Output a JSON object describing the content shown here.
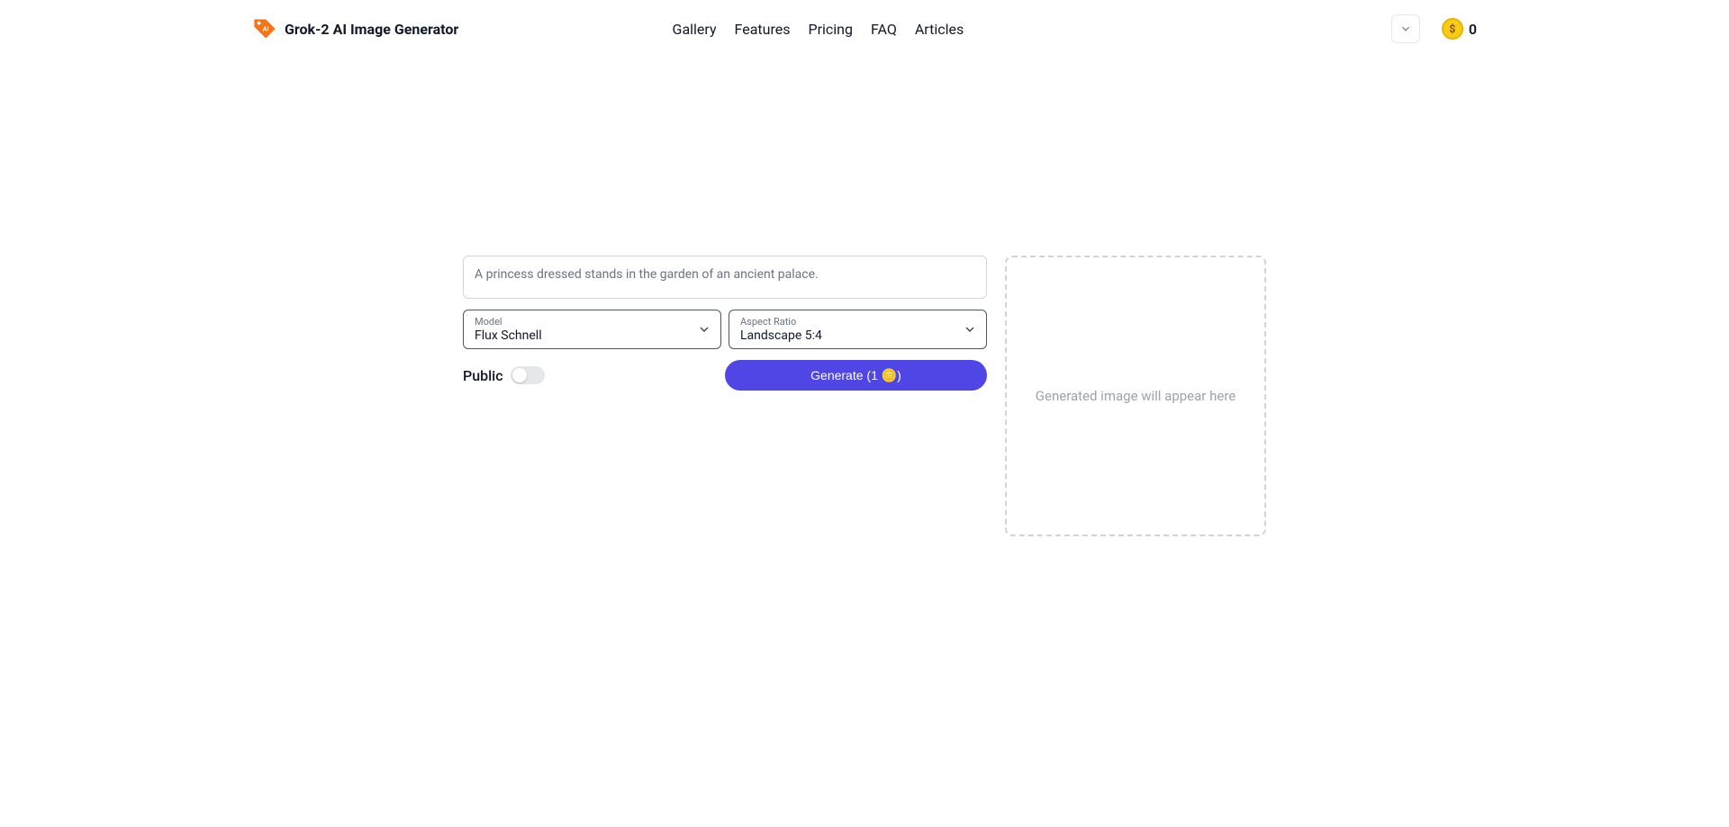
{
  "brand": {
    "title": "Grok-2 AI Image Generator"
  },
  "nav": {
    "gallery": "Gallery",
    "features": "Features",
    "pricing": "Pricing",
    "faq": "FAQ",
    "articles": "Articles"
  },
  "credits": {
    "symbol": "$",
    "value": "0"
  },
  "prompt": {
    "placeholder": "A princess dressed stands in the garden of an ancient palace."
  },
  "model": {
    "label": "Model",
    "value": "Flux Schnell"
  },
  "aspect": {
    "label": "Aspect Ratio",
    "value": "Landscape 5:4"
  },
  "toggle": {
    "label": "Public"
  },
  "generate": {
    "label": "Generate (1 🪙)"
  },
  "preview": {
    "placeholder": "Generated image will appear here"
  }
}
